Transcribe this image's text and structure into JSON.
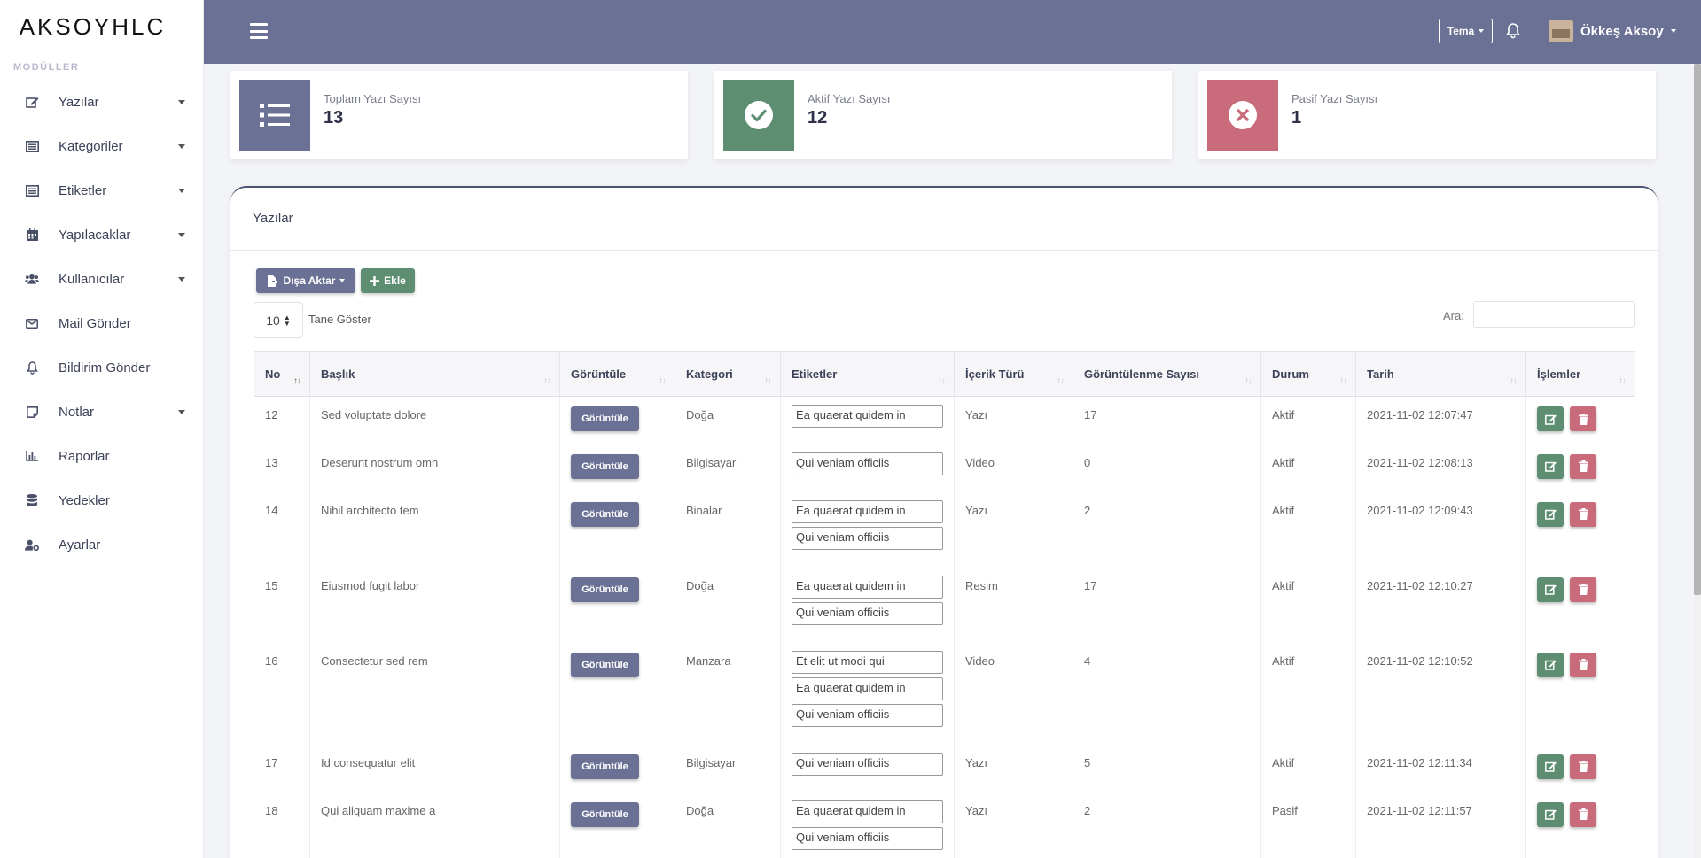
{
  "brand": "AKSOYHLC",
  "sidebar": {
    "heading": "MODÜLLER",
    "items": [
      {
        "label": "Yazılar",
        "icon": "edit-icon",
        "has_caret": true
      },
      {
        "label": "Kategoriler",
        "icon": "list-alt-icon",
        "has_caret": true
      },
      {
        "label": "Etiketler",
        "icon": "list-alt-icon",
        "has_caret": true
      },
      {
        "label": "Yapılacaklar",
        "icon": "calendar-icon",
        "has_caret": true
      },
      {
        "label": "Kullanıcılar",
        "icon": "users-icon",
        "has_caret": true
      },
      {
        "label": "Mail Gönder",
        "icon": "envelope-icon",
        "has_caret": false
      },
      {
        "label": "Bildirim Gönder",
        "icon": "bell-icon",
        "has_caret": false
      },
      {
        "label": "Notlar",
        "icon": "sticky-note-icon",
        "has_caret": true
      },
      {
        "label": "Raporlar",
        "icon": "chart-bar-icon",
        "has_caret": false
      },
      {
        "label": "Yedekler",
        "icon": "database-icon",
        "has_caret": false
      },
      {
        "label": "Ayarlar",
        "icon": "user-cog-icon",
        "has_caret": false
      }
    ]
  },
  "topbar": {
    "theme_label": "Tema",
    "user_name": "Ökkeş Aksoy"
  },
  "stats": [
    {
      "label": "Toplam Yazı Sayısı",
      "value": "13",
      "color": "#6a7194",
      "icon": "list-icon"
    },
    {
      "label": "Aktif Yazı Sayısı",
      "value": "12",
      "color": "#5e8e71",
      "icon": "check-circle-icon"
    },
    {
      "label": "Pasif Yazı Sayısı",
      "value": "1",
      "color": "#c96b7a",
      "icon": "times-circle-icon"
    }
  ],
  "card": {
    "title": "Yazılar",
    "export_label": "Dışa Aktar",
    "add_label": "Ekle",
    "page_length": "10",
    "page_length_label": "Tane Göster",
    "search_label": "Ara:"
  },
  "table": {
    "columns": [
      "No",
      "Başlık",
      "Görüntüle",
      "Kategori",
      "Etiketler",
      "İçerik Türü",
      "Görüntülenme Sayısı",
      "Durum",
      "Tarih",
      "İşlemler"
    ],
    "view_label": "Görüntüle",
    "rows": [
      {
        "no": "12",
        "title": "Sed voluptate dolore",
        "category": "Doğa",
        "tags": [
          "Ea quaerat quidem in"
        ],
        "type": "Yazı",
        "views": "17",
        "status": "Aktif",
        "date": "2021-11-02 12:07:47"
      },
      {
        "no": "13",
        "title": "Deserunt nostrum omn",
        "category": "Bilgisayar",
        "tags": [
          "Qui veniam officiis"
        ],
        "type": "Video",
        "views": "0",
        "status": "Aktif",
        "date": "2021-11-02 12:08:13"
      },
      {
        "no": "14",
        "title": "Nihil architecto tem",
        "category": "Binalar",
        "tags": [
          "Ea quaerat quidem in",
          "Qui veniam officiis"
        ],
        "type": "Yazı",
        "views": "2",
        "status": "Aktif",
        "date": "2021-11-02 12:09:43"
      },
      {
        "no": "15",
        "title": "Eiusmod fugit labor",
        "category": "Doğa",
        "tags": [
          "Ea quaerat quidem in",
          "Qui veniam officiis"
        ],
        "type": "Resim",
        "views": "17",
        "status": "Aktif",
        "date": "2021-11-02 12:10:27"
      },
      {
        "no": "16",
        "title": "Consectetur sed rem",
        "category": "Manzara",
        "tags": [
          "Et elit ut modi qui",
          "Ea quaerat quidem in",
          "Qui veniam officiis"
        ],
        "type": "Video",
        "views": "4",
        "status": "Aktif",
        "date": "2021-11-02 12:10:52"
      },
      {
        "no": "17",
        "title": "Id consequatur elit",
        "category": "Bilgisayar",
        "tags": [
          "Qui veniam officiis"
        ],
        "type": "Yazı",
        "views": "5",
        "status": "Aktif",
        "date": "2021-11-02 12:11:34"
      },
      {
        "no": "18",
        "title": "Qui aliquam maxime a",
        "category": "Doğa",
        "tags": [
          "Ea quaerat quidem in",
          "Qui veniam officiis"
        ],
        "type": "Yazı",
        "views": "2",
        "status": "Pasif",
        "date": "2021-11-02 12:11:57"
      }
    ]
  }
}
